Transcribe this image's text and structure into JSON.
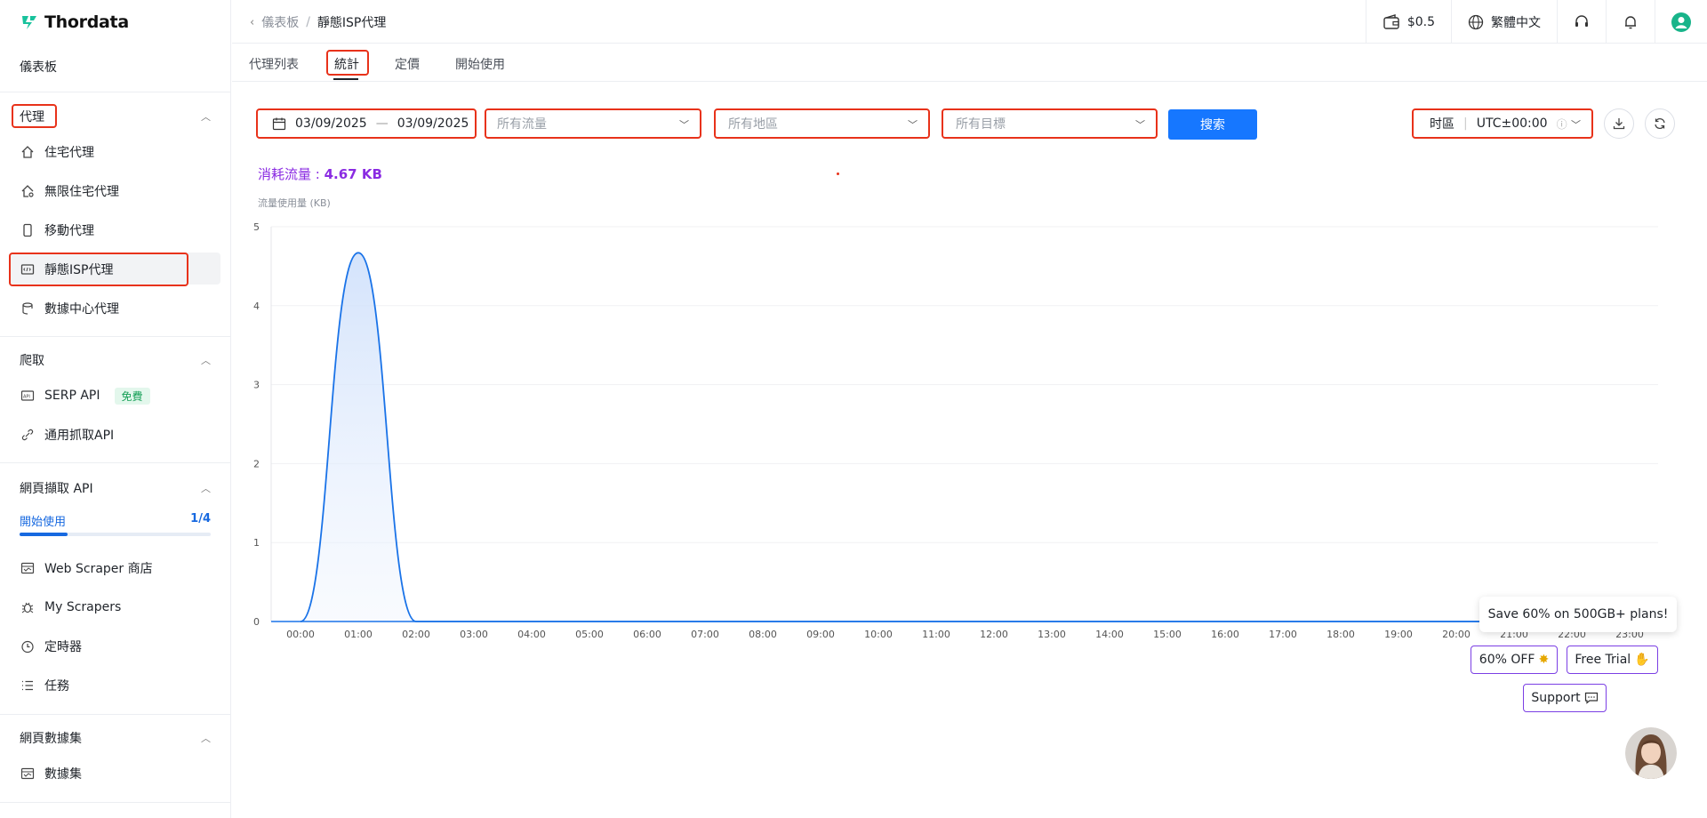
{
  "brand": {
    "name": "Thordata",
    "color": "#18c29c"
  },
  "sidebar": {
    "dashboard": "儀表板",
    "proxy_section": "代理",
    "proxy_items": [
      {
        "label": "住宅代理",
        "icon": "house-icon"
      },
      {
        "label": "無限住宅代理",
        "icon": "house-infinity-icon"
      },
      {
        "label": "移動代理",
        "icon": "mobile-icon"
      },
      {
        "label": "靜態ISP代理",
        "icon": "isp-icon"
      },
      {
        "label": "數據中心代理",
        "icon": "database-icon"
      }
    ],
    "scrape_section": "爬取",
    "scrape_items": [
      {
        "label": "SERP API",
        "icon": "api-icon",
        "badge": "免費"
      },
      {
        "label": "通用抓取API",
        "icon": "link-icon"
      }
    ],
    "webapi_section": "網頁擷取 API",
    "getting_started": {
      "label": "開始使用",
      "count": "1/4",
      "progress": 0.25
    },
    "webapi_items": [
      {
        "label": "Web Scraper 商店",
        "icon": "store-icon"
      },
      {
        "label": "My Scrapers",
        "icon": "bug-icon"
      },
      {
        "label": "定時器",
        "icon": "timer-icon"
      },
      {
        "label": "任務",
        "icon": "list-icon"
      }
    ],
    "dataset_section": "網頁數據集",
    "dataset_items": [
      {
        "label": "數據集",
        "icon": "dataset-icon"
      }
    ]
  },
  "topbar": {
    "breadcrumb_parent": "儀表板",
    "breadcrumb_current": "靜態ISP代理",
    "balance": "$0.5",
    "language": "繁體中文"
  },
  "tabs": [
    "代理列表",
    "統計",
    "定價",
    "開始使用"
  ],
  "filters": {
    "date_start": "03/09/2025",
    "date_end": "03/09/2025",
    "traffic_placeholder": "所有流量",
    "region_placeholder": "所有地區",
    "target_placeholder": "所有目標",
    "search_label": "搜索",
    "timezone_label": "时區",
    "timezone_value": "UTC±00:00"
  },
  "summary": {
    "label": "消耗流量 : ",
    "value": "4.67 KB"
  },
  "chart_data": {
    "type": "area",
    "ylabel": "流量使用量 (KB)",
    "ylim": [
      0,
      5
    ],
    "yticks": [
      "0",
      "1",
      "2",
      "3",
      "4",
      "5"
    ],
    "categories": [
      "00:00",
      "01:00",
      "02:00",
      "03:00",
      "04:00",
      "05:00",
      "06:00",
      "07:00",
      "08:00",
      "09:00",
      "10:00",
      "11:00",
      "12:00",
      "13:00",
      "14:00",
      "15:00",
      "16:00",
      "17:00",
      "18:00",
      "19:00",
      "20:00",
      "21:00",
      "22:00",
      "23:00"
    ],
    "values": [
      0,
      4.67,
      0,
      0,
      0,
      0,
      0,
      0,
      0,
      0,
      0,
      0,
      0,
      0,
      0,
      0,
      0,
      0,
      0,
      0,
      0,
      0,
      0,
      0
    ],
    "line_color": "#1a73e8",
    "grid": true
  },
  "promo": {
    "tip": "Save 60% on 500GB+ plans!",
    "discount": "60% OFF",
    "trial": "Free Trial",
    "support": "Support"
  }
}
